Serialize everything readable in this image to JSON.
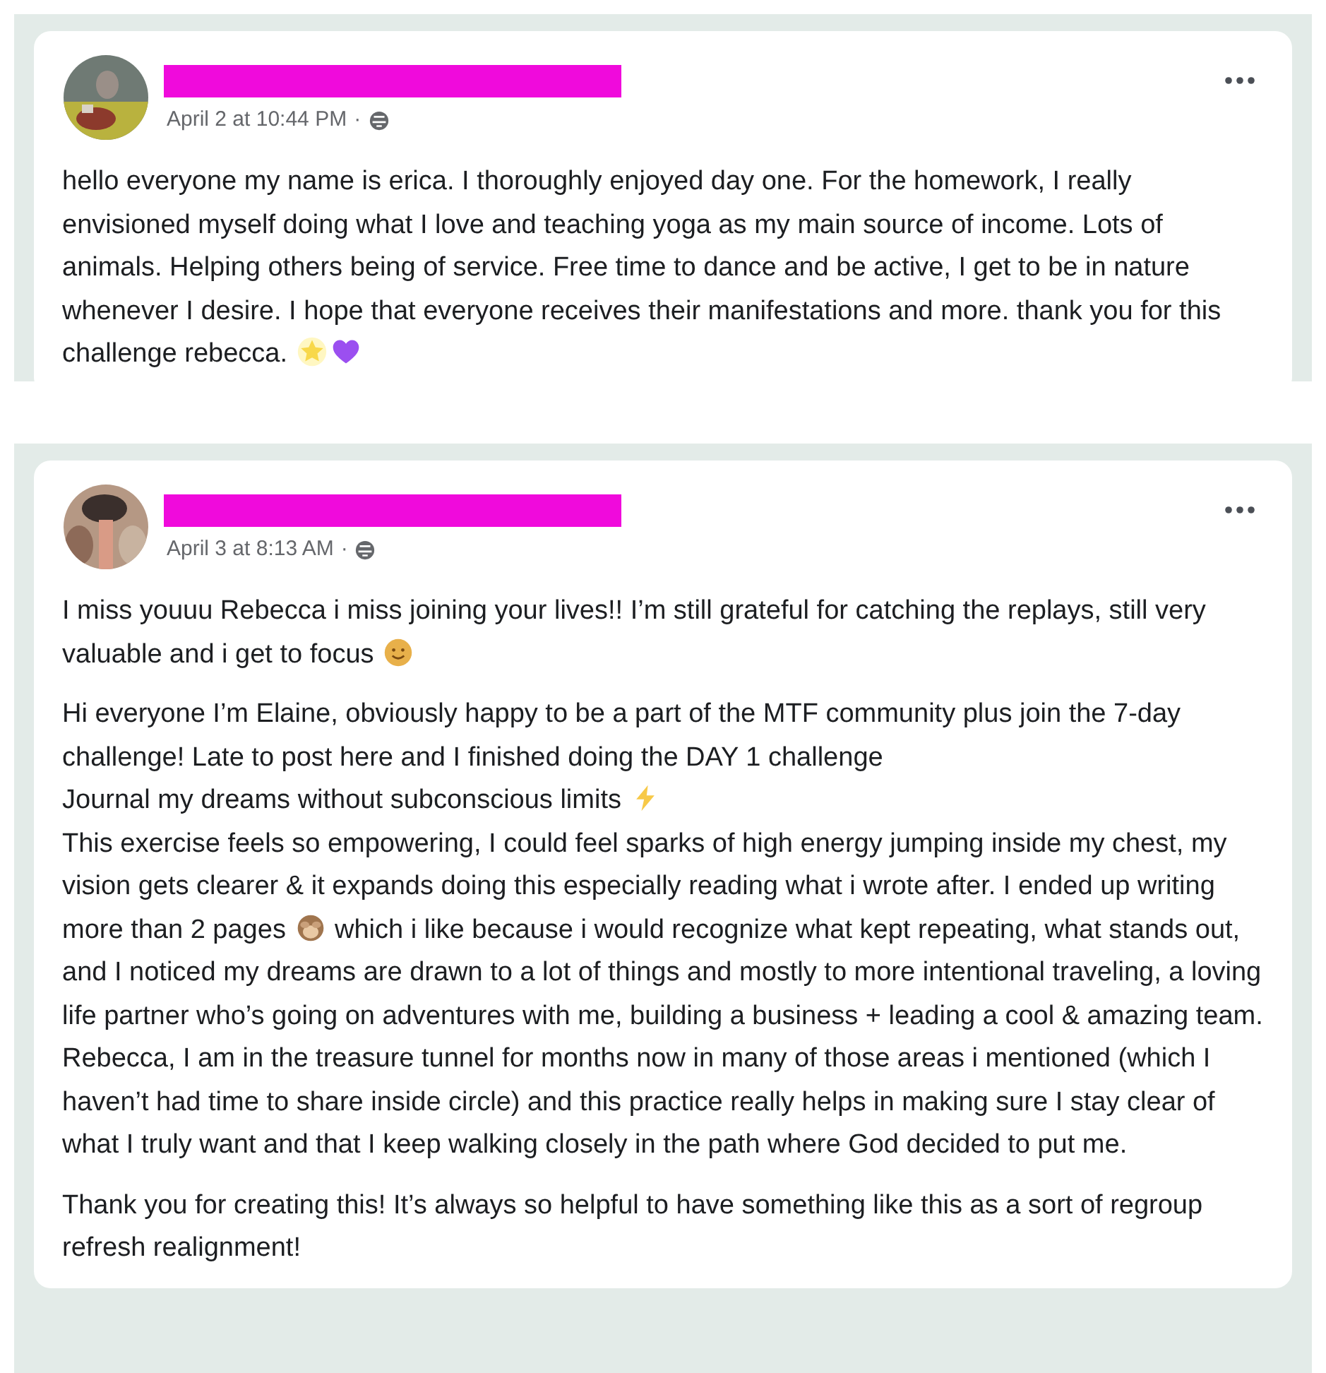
{
  "posts": [
    {
      "time": "April 2 at 10:44 PM",
      "separator": "·",
      "paragraphs": [
        {
          "segments": [
            {
              "kind": "text",
              "text": "hello everyone my name is erica. I thoroughly enjoyed day one. For the homework, I really envisioned myself doing what I love and teaching yoga as my main source of income. Lots of animals. Helping others being of service. Free time to dance and be active, I get to be in nature whenever I desire. I hope that everyone receives their manifestations and more. thank you for this challenge rebecca. "
            },
            {
              "kind": "star"
            },
            {
              "kind": "heart"
            }
          ]
        }
      ]
    },
    {
      "time": "April 3 at 8:13 AM",
      "separator": "·",
      "paragraphs": [
        {
          "segments": [
            {
              "kind": "text",
              "text": "I miss youuu Rebecca i miss joining your lives!! I’m still grateful for catching the replays, still very valuable and i get to focus "
            },
            {
              "kind": "smile"
            }
          ]
        },
        {
          "segments": [
            {
              "kind": "text",
              "text": "Hi everyone I’m Elaine, obviously happy to be a part of the MTF community plus join the 7-day challenge! Late to post here and I finished doing the DAY 1 challenge"
            },
            {
              "kind": "break"
            },
            {
              "kind": "text",
              "text": "Journal my dreams without subconscious limits "
            },
            {
              "kind": "bolt"
            },
            {
              "kind": "break"
            },
            {
              "kind": "text",
              "text": "This exercise feels so empowering, I could feel sparks of high energy jumping inside my chest, my vision gets clearer & it expands doing this especially reading what i wrote after. I ended up writing more than 2 pages "
            },
            {
              "kind": "monkey"
            },
            {
              "kind": "text",
              "text": " which i like because i would recognize what kept repeating, what stands out, and I noticed my dreams are drawn to a lot of things and mostly to more intentional traveling, a loving life partner who’s going on adventures with me, building a business + leading a cool & amazing team. Rebecca, I am in the treasure tunnel for months now in many of those areas i mentioned (which I haven’t had time to share inside circle) and this practice really helps in making sure I stay clear of what I truly want and that I keep walking closely in the path where God decided to put me."
            }
          ]
        },
        {
          "segments": [
            {
              "kind": "text",
              "text": "Thank you for creating this! It’s always so helpful to have something like this as a sort of regroup refresh realignment!"
            }
          ]
        }
      ]
    }
  ]
}
